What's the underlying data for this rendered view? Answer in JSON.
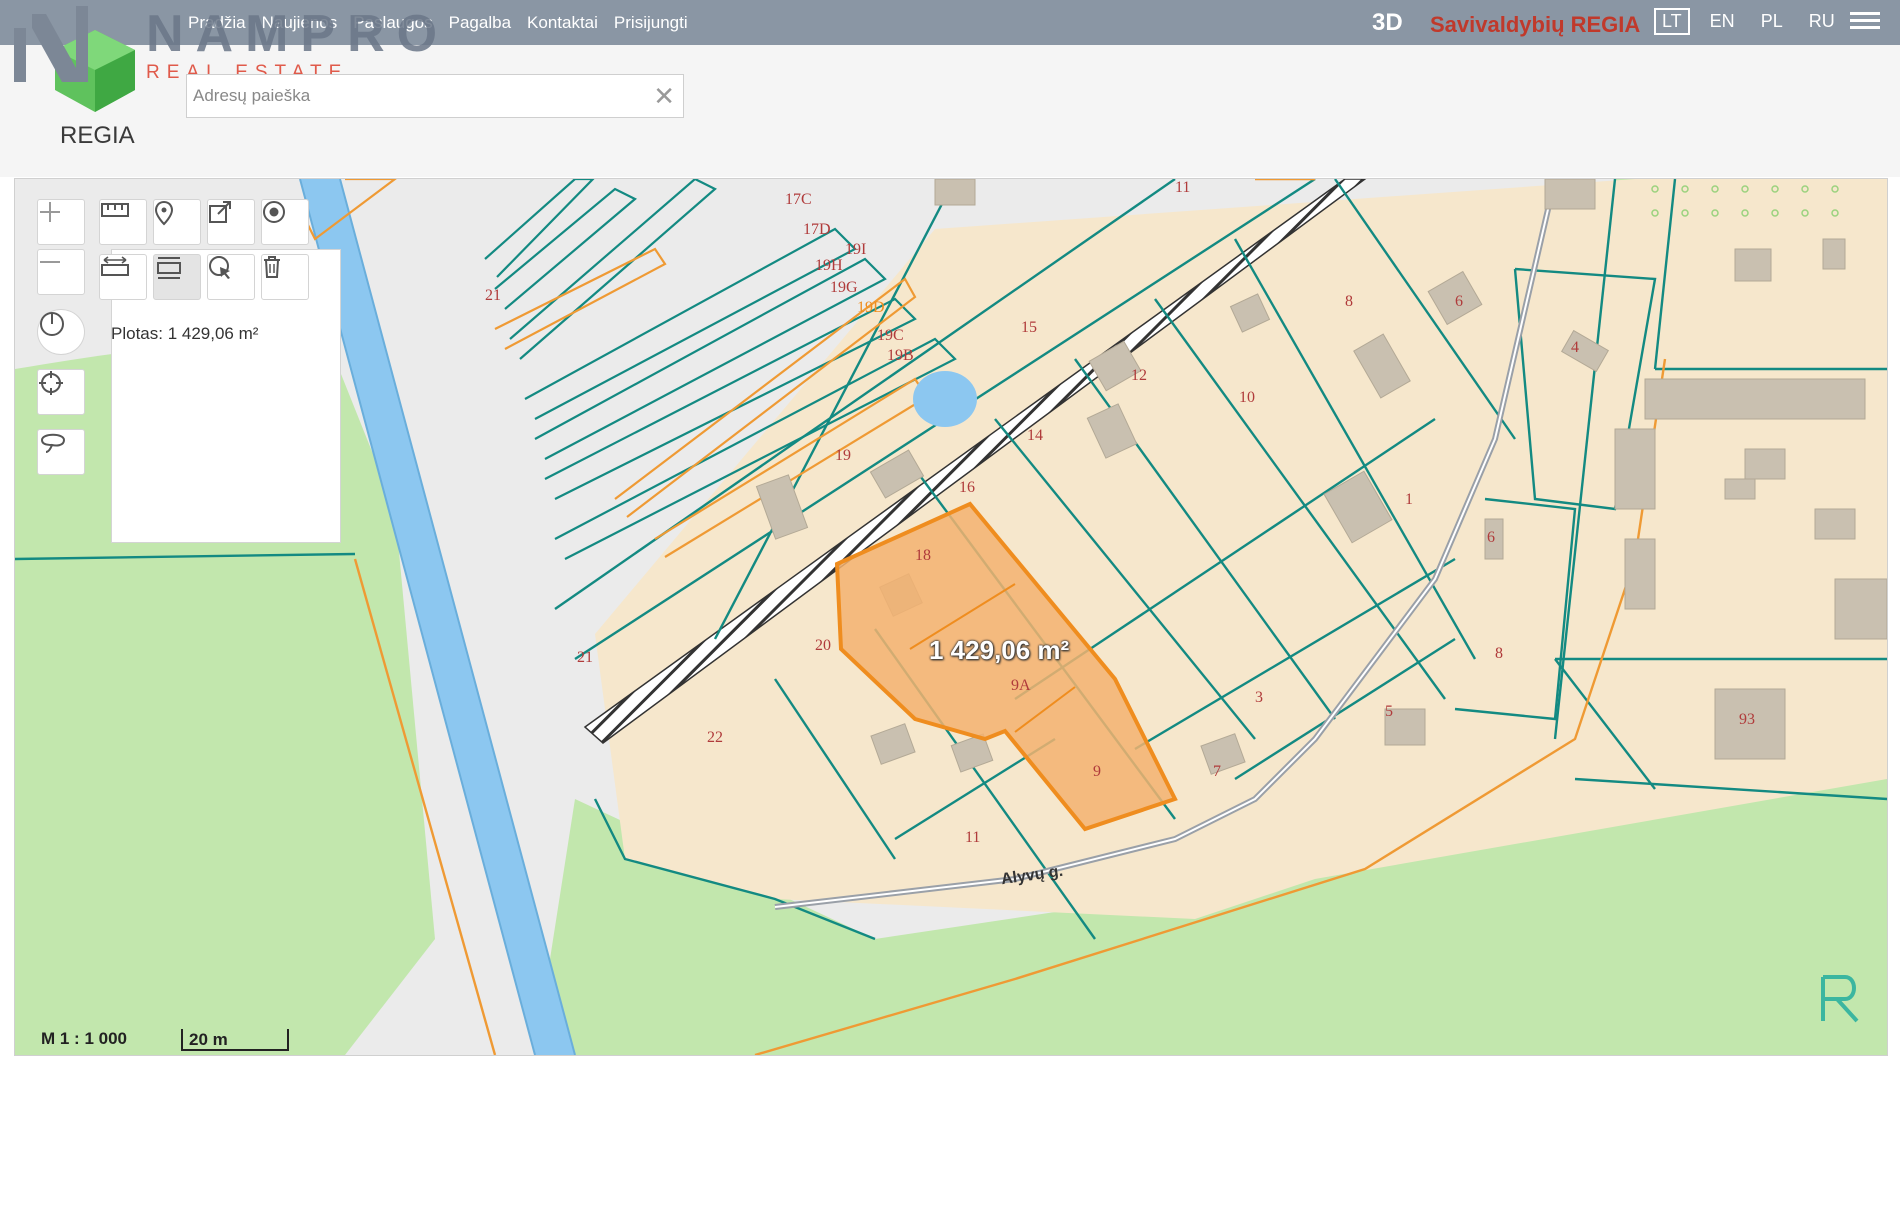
{
  "header": {
    "nav": [
      "Pradžia",
      "Naujienos",
      "Paslaugos",
      "Pagalba",
      "Kontaktai",
      "Prisijungti"
    ],
    "btn_3d": "3D",
    "brand": "Savivaldybių REGIA",
    "languages": [
      "LT",
      "EN",
      "PL",
      "RU"
    ],
    "active_language": "LT",
    "logo_text": "REGIA"
  },
  "watermark": {
    "name": "NAMPRO",
    "tagline": "REAL ESTATE"
  },
  "search": {
    "placeholder": "Adresų paieška",
    "clear_icon": "close-icon"
  },
  "map": {
    "area_info": "Plotas: 1 429,06 m²",
    "area_label": "1 429,06 m²",
    "scale_text": "M 1 : 1 000",
    "scale_bar_label": "20 m",
    "street_label": "Alyvų g.",
    "parcel_labels": [
      "17C",
      "17D",
      "19I",
      "19H",
      "19G",
      "19D",
      "19C",
      "19B",
      "11",
      "15",
      "8",
      "6",
      "4",
      "12",
      "10",
      "14",
      "19",
      "16",
      "1",
      "6",
      "18",
      "20",
      "21",
      "22",
      "3",
      "9A",
      "9",
      "7",
      "5",
      "8",
      "93",
      "11",
      "21"
    ],
    "colors": {
      "parcel_fill": "#f6e7cc",
      "parcel_border": "#138a82",
      "selection_fill": "#f3b170",
      "selection_border": "#ef8d1f",
      "water": "#8cc7f0",
      "green": "#bfe5a6",
      "label": "#b03b3b"
    }
  },
  "tools": {
    "zoom_in": "plus-icon",
    "zoom_out": "minus-icon",
    "measure": "ruler-icon",
    "pin": "map-pin-icon",
    "share": "share-icon",
    "target": "target-icon",
    "measure_distance": "distance-icon",
    "measure_area": "area-icon",
    "select": "select-icon",
    "delete": "trash-icon",
    "history": "power-icon",
    "locate": "crosshair-icon",
    "draw": "lasso-icon"
  }
}
